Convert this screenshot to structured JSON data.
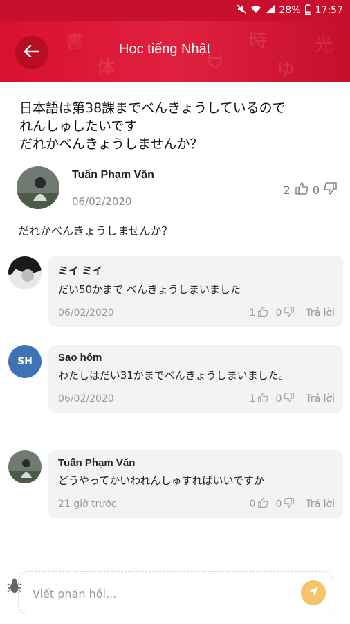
{
  "status_bar": {
    "battery": "28%",
    "time": "17:57"
  },
  "header": {
    "title": "Học tiếng Nhật",
    "back_icon": "arrow-left-icon"
  },
  "post": {
    "question_lines": [
      "日本語は第38課までべんきょうしているので",
      "れんしゅしたいです",
      "だれかべんきょうしませんか？"
    ],
    "author": "Tuấn Phạm Văn",
    "date": "06/02/2020",
    "likes": "2",
    "dislikes": "0",
    "body": "だれかべんきょうしませんか？"
  },
  "comments": [
    {
      "name": "ミイ ミイ",
      "text": "だい50かまで べんきょうしまいました",
      "date": "06/02/2020",
      "likes": "1",
      "dislikes": "0",
      "reply": "Trả lời"
    },
    {
      "name": "Sao hôm",
      "avatar_initials": "SH",
      "text": "わたしはだい31かまでべんきょうしまいました。",
      "date": "06/02/2020",
      "likes": "1",
      "dislikes": "0",
      "reply": "Trả lời"
    },
    {
      "name": "Tuấn Phạm Văn",
      "text": "どうやってかいわれんしゅすればいいですか",
      "date": "21 giờ trước",
      "likes": "0",
      "dislikes": "0",
      "reply": "Trả lời"
    }
  ],
  "composer": {
    "placeholder": "Viết phản hồi..."
  },
  "colors": {
    "brand": "#d8112d",
    "send": "#f5c36a",
    "avatar_sh": "#3f73b5"
  }
}
